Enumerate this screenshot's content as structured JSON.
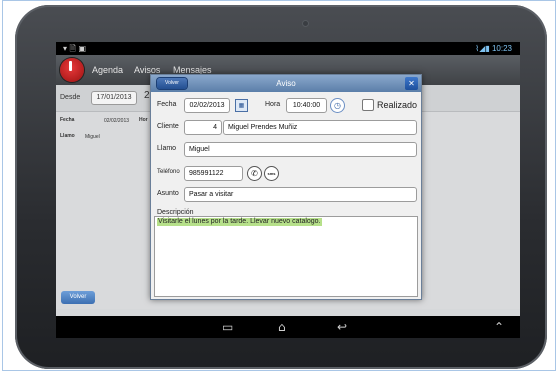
{
  "statusbar": {
    "left_icons": "▾ 🗎 ▣",
    "time": "10:23"
  },
  "appbar": {
    "nav_items": [
      "Agenda",
      "Avisos",
      "Mensajes"
    ]
  },
  "filter": {
    "desde_label": "Desde",
    "desde_value": "17/01/2013",
    "second_value": "2"
  },
  "list_preview": {
    "fecha_label": "Fecha",
    "fecha_value": "02/02/2013",
    "hora_label": "Hor",
    "llamo_label": "Llamo",
    "llamo_value": "Miguel"
  },
  "background_back": "Volver",
  "dialog": {
    "title": "Aviso",
    "back_label": "Volver",
    "fecha_label": "Fecha",
    "fecha_value": "02/02/2013",
    "hora_label": "Hora",
    "hora_value": "10:40:00",
    "realizado_label": "Realizado",
    "realizado_checked": false,
    "cliente_label": "Cliente",
    "cliente_id": "4",
    "cliente_name": "Miguel Prendes Muñiz",
    "llamo_label": "Llamo",
    "llamo_value": "Miguel",
    "telefono_label": "Teléfono",
    "telefono_value": "985991122",
    "sms_label": "sms",
    "asunto_label": "Asunto",
    "asunto_value": "Pasar a visitar",
    "descripcion_label": "Descripción",
    "descripcion_value": "Visitarle el lunes por la tarde. Llevar nuevo catalogo."
  },
  "colors": {
    "header_blue": "#5b7ea9",
    "highlight_green": "#b6e08a",
    "logo_red": "#d62a2a"
  },
  "icons": [
    "calendar-icon",
    "clock-icon",
    "phone-icon",
    "sms-icon",
    "close-icon",
    "back-nav-icon",
    "home-nav-icon",
    "recents-nav-icon",
    "chevron-up-icon"
  ]
}
